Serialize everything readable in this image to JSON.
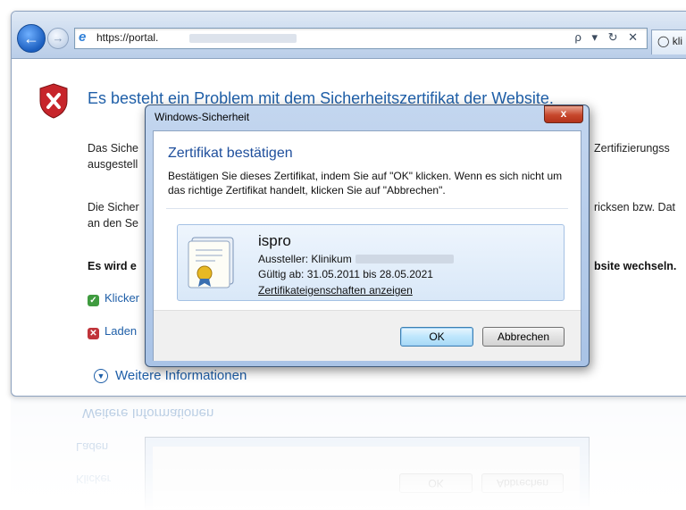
{
  "browser": {
    "url_text": "https://portal.",
    "tab_label": "kli",
    "address_icons": "ρ ▾ ↻ ✕"
  },
  "page": {
    "title": "Es besteht ein Problem mit dem Sicherheitszertifikat der Website.",
    "para1_left": "Das Siche",
    "para1_left2": "ausgestell",
    "para1_right": "Zertifizierungss",
    "para2_left": "Die Sicher",
    "para2_left2": "an den Se",
    "para2_right": "ricksen bzw. Dat",
    "bold_left": "Es wird e",
    "bold_right": "bsite wechseln.",
    "link1": "Klicker",
    "link2": "Laden",
    "more_info": "Weitere Informationen"
  },
  "dialog": {
    "title": "Windows-Sicherheit",
    "close_label": "x",
    "heading": "Zertifikat bestätigen",
    "text": "Bestätigen Sie dieses Zertifikat, indem Sie auf \"OK\" klicken. Wenn es sich nicht um das richtige Zertifikat handelt, klicken Sie auf \"Abbrechen\".",
    "cert": {
      "name": "ispro",
      "issuer_label": "Aussteller: Klinikum",
      "valid": "Gültig ab: 31.05.2011 bis 28.05.2021",
      "link": "Zertifikateigenschaften anzeigen"
    },
    "ok_label": "OK",
    "cancel_label": "Abbrechen"
  },
  "reflection": {
    "more_info": "Weitere Informationen",
    "link2": "Laden",
    "link1": "Klicker",
    "ok_label": "OK",
    "cancel_label": "Abbrechen"
  }
}
